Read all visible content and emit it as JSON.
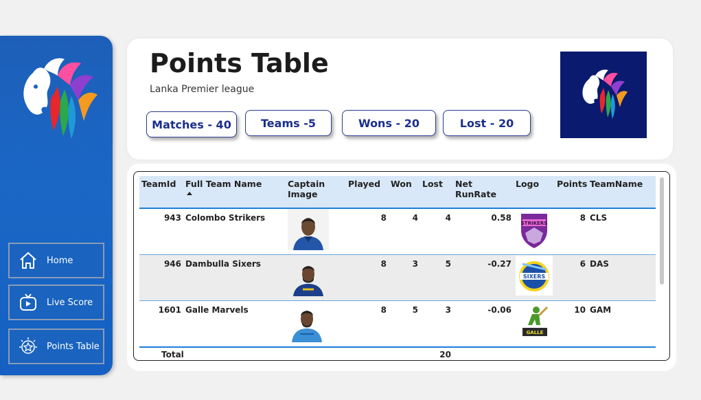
{
  "sidebar": {
    "logo_icon": "lion-logo-icon",
    "items": [
      {
        "label": "Home",
        "icon": "home-icon"
      },
      {
        "label": "Live Score",
        "icon": "tv-icon"
      },
      {
        "label": "Points Table",
        "icon": "star-badge-icon"
      }
    ]
  },
  "header": {
    "title": "Points Table",
    "subtitle": "Lanka Premier league",
    "kpis": [
      {
        "label": "Matches - 40"
      },
      {
        "label": "Teams -5"
      },
      {
        "label": "Wons - 20"
      },
      {
        "label": "Lost - 20"
      }
    ],
    "brand_icon": "lion-logo-icon"
  },
  "table": {
    "columns": [
      "TeamId",
      "Full Team Name",
      "Captain Image",
      "Played",
      "Won",
      "Lost",
      "Net RunRate",
      "Logo",
      "Points",
      "TeamName"
    ],
    "rows": [
      {
        "team_id": "943",
        "full_name": "Colombo Strikers",
        "played": "8",
        "won": "4",
        "lost": "4",
        "nrr": "0.58",
        "points": "8",
        "team_name": "CLS",
        "logo_text": "STRIKERS",
        "logo_color": "#7a2a9c"
      },
      {
        "team_id": "946",
        "full_name": "Dambulla Sixers",
        "played": "8",
        "won": "3",
        "lost": "5",
        "nrr": "-0.27",
        "points": "6",
        "team_name": "DAS",
        "logo_text": "SIXERS",
        "logo_color": "#1b4fa8"
      },
      {
        "team_id": "1601",
        "full_name": "Galle Marvels",
        "played": "8",
        "won": "5",
        "lost": "3",
        "nrr": "-0.06",
        "points": "10",
        "team_name": "GAM",
        "logo_text": "GALLE",
        "logo_color": "#4a9a2a"
      }
    ],
    "total_label": "Total",
    "total_lost": "20"
  },
  "colors": {
    "sidebar": "#1a63bf",
    "kpi_text": "#1b2e8a",
    "header_row": "#d8e8f8",
    "brand_box": "#0a1a6e"
  }
}
